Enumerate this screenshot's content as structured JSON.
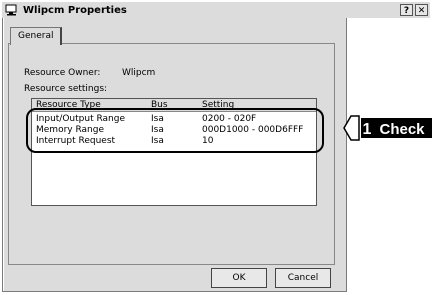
{
  "window": {
    "title": "Wlipcm Properties",
    "help_btn": "?",
    "close_btn": "✕"
  },
  "tabs": [
    {
      "label": "General"
    }
  ],
  "resource_owner": {
    "label": "Resource Owner:",
    "value": "Wlipcm"
  },
  "resource_settings": {
    "label": "Resource settings:"
  },
  "table": {
    "columns": [
      "Resource Type",
      "Bus",
      "Setting"
    ],
    "rows": [
      {
        "type": "Input/Output Range",
        "bus": "Isa",
        "setting": "0200 - 020F"
      },
      {
        "type": "Memory Range",
        "bus": "Isa",
        "setting": "000D1000 - 000D6FFF"
      },
      {
        "type": "Interrupt Request",
        "bus": "Isa",
        "setting": "10"
      }
    ]
  },
  "buttons": {
    "ok": "OK",
    "cancel": "Cancel"
  },
  "callout": {
    "number": "1",
    "label": "Check"
  }
}
